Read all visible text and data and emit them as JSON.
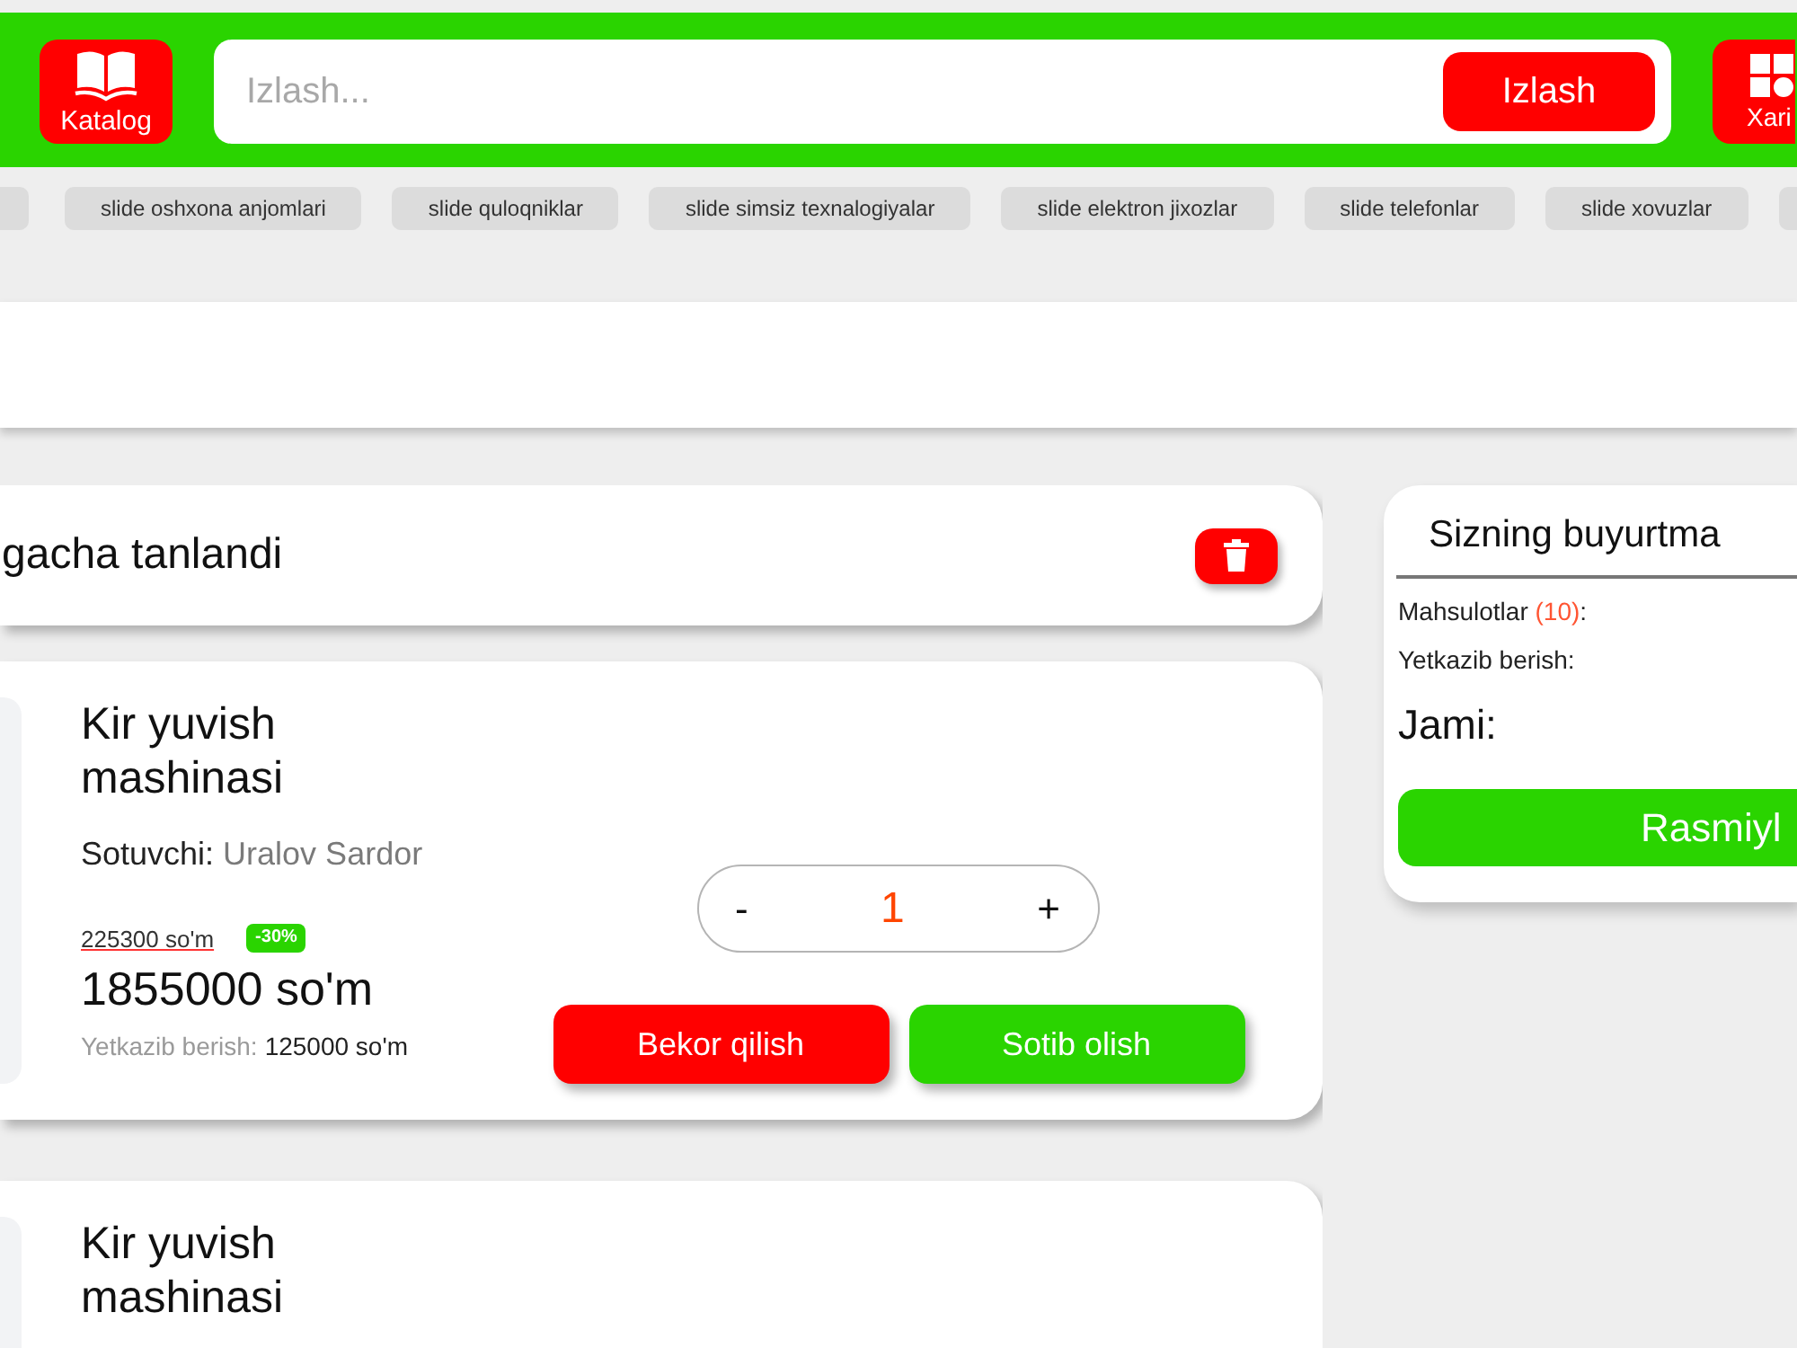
{
  "header": {
    "catalog_button": {
      "label": "Katalog"
    },
    "search": {
      "placeholder": "Izlash...",
      "button": "Izlash"
    },
    "cart_button": {
      "label": "Xari"
    }
  },
  "categories": [
    {
      "kind": "cut"
    },
    {
      "kind": "chip",
      "label": "slide oshxona anjomlari"
    },
    {
      "kind": "chip",
      "label": "slide quloqniklar"
    },
    {
      "kind": "chip",
      "label": "slide simsiz texnalogiyalar"
    },
    {
      "kind": "chip",
      "label": "slide elektron jixozlar"
    },
    {
      "kind": "chip",
      "label": "slide telefonlar"
    },
    {
      "kind": "chip",
      "label": "slide xovuzlar"
    },
    {
      "kind": "cut"
    }
  ],
  "selection": {
    "text": "gacha tanlandi"
  },
  "products": [
    {
      "title": "Kir yuvish mashinasi",
      "seller_label": "Sotuvchi:",
      "seller": "Uralov Sardor",
      "old_price": "225300 so'm",
      "discount": "-30%",
      "price": "1855000 so'm",
      "delivery_label": "Yetkazib berish:",
      "delivery_price": "125000 so'm",
      "quantity": {
        "minus": "-",
        "value": "1",
        "plus": "+"
      },
      "buttons": [
        {
          "kind": "cancel",
          "label": "Bekor qilish"
        },
        {
          "kind": "buy",
          "label": "Sotib olish"
        }
      ]
    },
    {
      "title": "Kir yuvish mashinasi"
    }
  ],
  "order_summary": {
    "title": "Sizning buyurtma",
    "products_label": "Mahsulotlar ",
    "products_count": "(10)",
    "products_suffix": ":",
    "delivery_label": "Yetkazib berish:",
    "total_label": "Jami:",
    "checkout_button": "Rasmiyl"
  }
}
